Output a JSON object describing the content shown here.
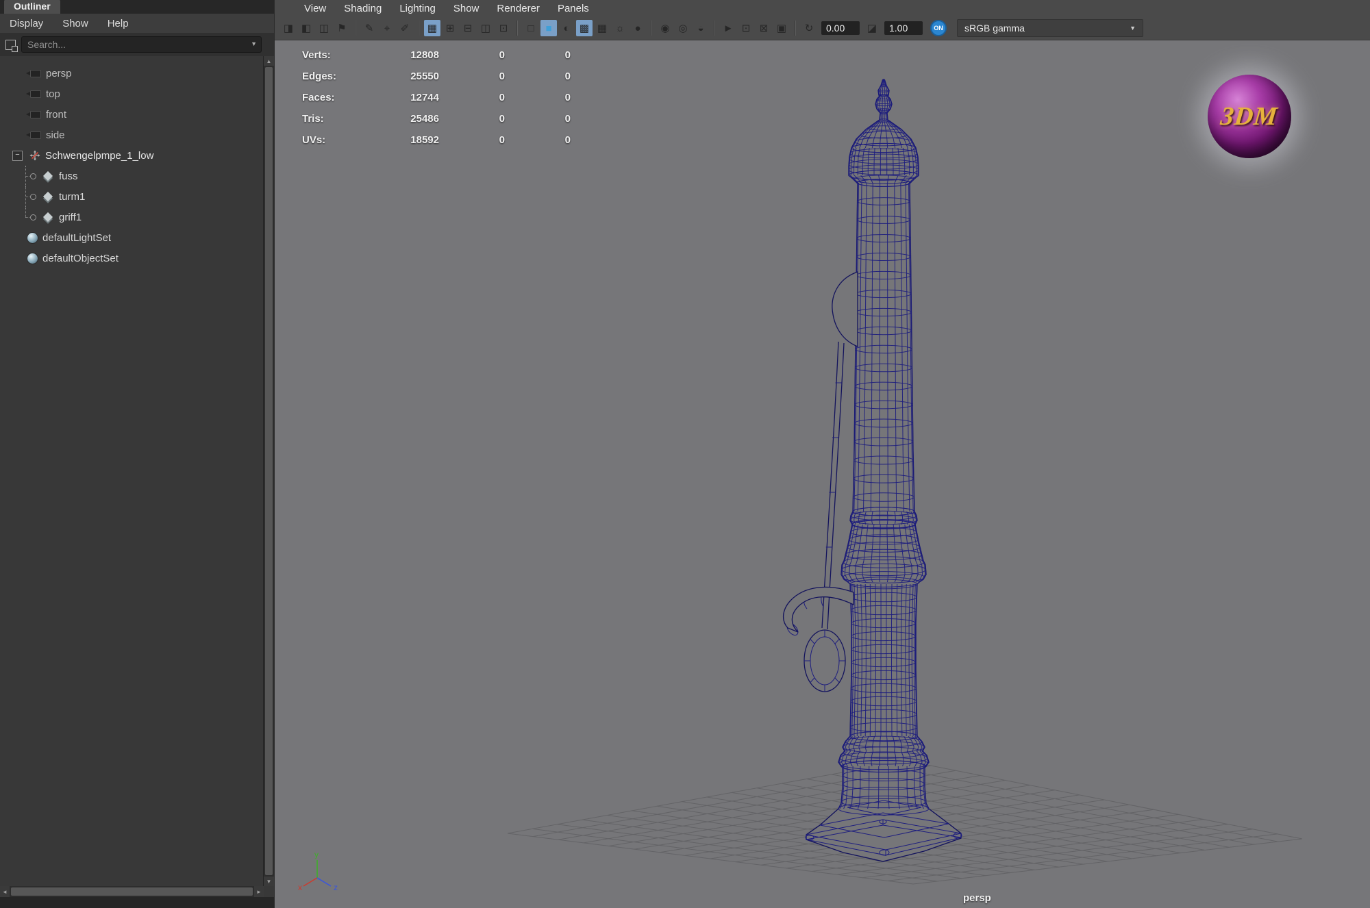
{
  "icons": {
    "chevron_down": "▼",
    "scroll_up": "▲",
    "scroll_down": "▼",
    "scroll_left": "◄",
    "scroll_right": "►",
    "collapse_minus": "−"
  },
  "outliner": {
    "tab": "Outliner",
    "menu": [
      "Display",
      "Show",
      "Help"
    ],
    "search_placeholder": "Search...",
    "tree": [
      {
        "label": "persp"
      },
      {
        "label": "top"
      },
      {
        "label": "front"
      },
      {
        "label": "side"
      },
      {
        "label": "Schwengelpmpe_1_low"
      },
      {
        "label": "fuss"
      },
      {
        "label": "turm1"
      },
      {
        "label": "griff1"
      },
      {
        "label": "defaultLightSet"
      },
      {
        "label": "defaultObjectSet"
      }
    ]
  },
  "viewport": {
    "menu": [
      "View",
      "Shading",
      "Lighting",
      "Show",
      "Renderer",
      "Panels"
    ],
    "hud": {
      "rows": [
        {
          "label": "Verts:",
          "value": "12808",
          "col2": "0",
          "col3": "0"
        },
        {
          "label": "Edges:",
          "value": "25550",
          "col2": "0",
          "col3": "0"
        },
        {
          "label": "Faces:",
          "value": "12744",
          "col2": "0",
          "col3": "0"
        },
        {
          "label": "Tris:",
          "value": "25486",
          "col2": "0",
          "col3": "0"
        },
        {
          "label": "UVs:",
          "value": "18592",
          "col2": "0",
          "col3": "0"
        }
      ]
    },
    "camera_label": "persp",
    "axis": {
      "x": "x",
      "y": "y",
      "z": "z"
    },
    "logo_text": "3DM",
    "colors": {
      "wireframe": "#1d1d7e",
      "viewport_bg": "#767679",
      "active_highlight": "#7aa0c8",
      "toggle_blue": "#2b86d0"
    }
  },
  "toolbar": {
    "items": [
      {
        "type": "icon",
        "name": "camera-bookmark-icon",
        "glyph": "◨"
      },
      {
        "type": "icon",
        "name": "camera-add-icon",
        "glyph": "◧"
      },
      {
        "type": "icon",
        "name": "camera-select-icon",
        "glyph": "◫"
      },
      {
        "type": "icon",
        "name": "bookmark-flag-icon",
        "glyph": "⚑"
      },
      {
        "type": "sep"
      },
      {
        "type": "icon",
        "name": "pencil-tool-icon",
        "glyph": "✎"
      },
      {
        "type": "icon",
        "name": "pivot-tool-icon",
        "glyph": "⌖"
      },
      {
        "type": "icon",
        "name": "brush-tool-icon",
        "glyph": "✐"
      },
      {
        "type": "sep"
      },
      {
        "type": "icon",
        "name": "single-pane-layout-icon",
        "glyph": "▦",
        "active": true
      },
      {
        "type": "icon",
        "name": "four-pane-layout-icon",
        "glyph": "⊞"
      },
      {
        "type": "icon",
        "name": "two-pane-layout-icon",
        "glyph": "⊟"
      },
      {
        "type": "icon",
        "name": "split-pane-layout-icon",
        "glyph": "◫"
      },
      {
        "type": "icon",
        "name": "pane-text-icon",
        "glyph": "⊡"
      },
      {
        "type": "sep"
      },
      {
        "type": "icon",
        "name": "wireframe-mode-icon",
        "glyph": "□"
      },
      {
        "type": "icon",
        "name": "smooth-shade-mode-icon",
        "glyph": "■",
        "color": "#3f9fd8",
        "active": true
      },
      {
        "type": "icon",
        "name": "shade-wire-mode-icon",
        "glyph": "◐"
      },
      {
        "type": "icon",
        "name": "textured-mode-icon",
        "glyph": "▩",
        "active": true
      },
      {
        "type": "icon",
        "name": "checker-map-icon",
        "glyph": "▦"
      },
      {
        "type": "icon",
        "name": "use-all-lights-icon",
        "glyph": "☼"
      },
      {
        "type": "icon",
        "name": "shadows-icon",
        "glyph": "●"
      },
      {
        "type": "sep"
      },
      {
        "type": "icon",
        "name": "screen-space-ao-icon",
        "glyph": "◉"
      },
      {
        "type": "icon",
        "name": "motion-blur-icon",
        "glyph": "◎"
      },
      {
        "type": "icon",
        "name": "multisample-icon",
        "glyph": "◒"
      },
      {
        "type": "sep"
      },
      {
        "type": "icon",
        "name": "select-highlight-icon",
        "glyph": "►"
      },
      {
        "type": "icon",
        "name": "frame-selected-icon",
        "glyph": "⊡"
      },
      {
        "type": "icon",
        "name": "frame-all-icon",
        "glyph": "⊠"
      },
      {
        "type": "icon",
        "name": "image-plane-icon",
        "glyph": "▣"
      },
      {
        "type": "sep"
      },
      {
        "type": "icon",
        "name": "exposure-icon",
        "glyph": "↻"
      },
      {
        "type": "field",
        "name": "exposure-field",
        "value": "0.00"
      },
      {
        "type": "icon",
        "name": "gamma-icon",
        "glyph": "◪"
      },
      {
        "type": "field",
        "name": "gamma-field",
        "value": "1.00"
      },
      {
        "type": "toggle",
        "name": "color-management-toggle",
        "label": "ON"
      },
      {
        "type": "dropdown",
        "name": "view-transform-dropdown",
        "label": "sRGB gamma"
      }
    ]
  }
}
